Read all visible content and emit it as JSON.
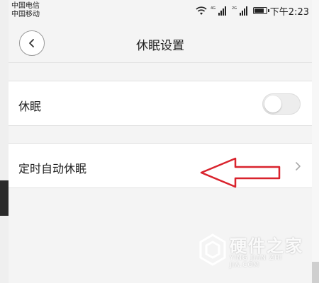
{
  "status_bar": {
    "carrier_1": "中国电信",
    "carrier_2": "中国移动",
    "network_1": "4G",
    "network_2": "2G",
    "time": "下午2:23",
    "battery_level": 0.85
  },
  "header": {
    "title": "休眠设置",
    "back_icon": "chevron-left-icon"
  },
  "settings": {
    "sleep": {
      "label": "休眠",
      "enabled": false
    },
    "timed_sleep": {
      "label": "定时自动休眠",
      "icon": "chevron-right-icon"
    }
  },
  "annotation": {
    "arrow_color": "#d9232d"
  },
  "watermark": {
    "text": "硬件之家",
    "subtext": "YING JIAN ZHI JIA.COM"
  }
}
